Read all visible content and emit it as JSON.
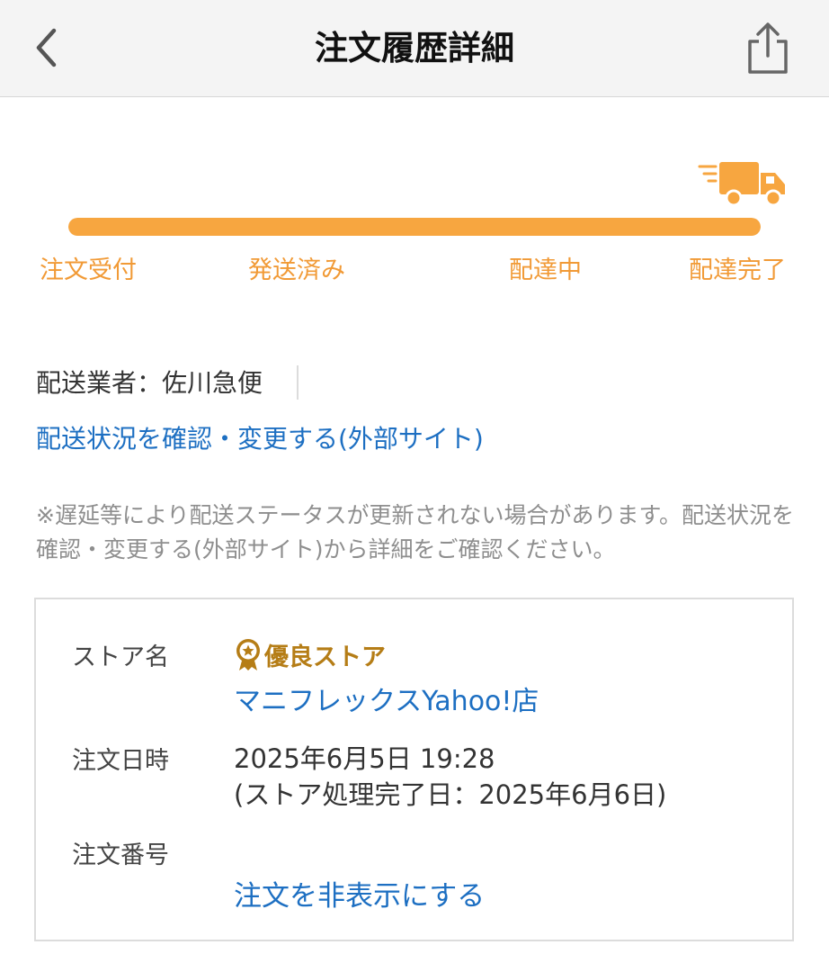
{
  "header": {
    "title": "注文履歴詳細"
  },
  "progress": {
    "value": 1.0,
    "steps": [
      "注文受付",
      "発送済み",
      "配達中",
      "配達完了"
    ]
  },
  "shipping": {
    "carrier_line": "配送業者：佐川急便",
    "status_link": "配送状況を確認・変更する(外部サイト)",
    "note": "※遅延等により配送ステータスが更新されない場合があります。配送状況を確認・変更する(外部サイト)から詳細をご確認ください。"
  },
  "order": {
    "store_label": "ストア名",
    "badge": "優良ストア",
    "store_name": "マニフレックスYahoo!店",
    "date_label": "注文日時",
    "date_value": "2025年6月5日 19:28",
    "process_date": "(ストア処理完了日：2025年6月6日)",
    "number_label": "注文番号",
    "hide_link": "注文を非表示にする"
  },
  "colors": {
    "accent": "#f7a640",
    "step_text": "#f19a36",
    "link": "#1d6fc2",
    "badge": "#b57d16"
  },
  "icons": {
    "back": "chevron-left-icon",
    "share": "share-icon",
    "truck": "truck-icon",
    "badge": "ribbon-badge-icon"
  }
}
